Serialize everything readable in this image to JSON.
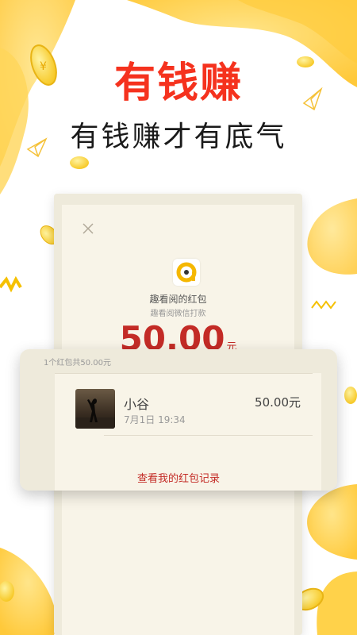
{
  "banner": {
    "title": "有钱赚",
    "subtitle": "有钱赚才有底气"
  },
  "red_packet": {
    "sender_name": "趣看阅的红包",
    "sender_sub": "趣看阅微信打款",
    "amount": "50.00",
    "unit": "元",
    "summary": "1个红包共50.00元",
    "recipient": {
      "name": "小谷",
      "time": "7月1日  19:34",
      "amount": "50.00元"
    },
    "record_link": "查看我的红包记录"
  },
  "colors": {
    "title_red": "#f5321e",
    "accent_red": "#c32b26",
    "card_bg": "#f8f4e8",
    "card_border": "#eeeadb",
    "coin_yellow": "#ffd23c"
  },
  "icons": [
    "close-icon",
    "app-logo-icon",
    "coin-icon",
    "paper-plane-icon",
    "zigzag-icon"
  ]
}
